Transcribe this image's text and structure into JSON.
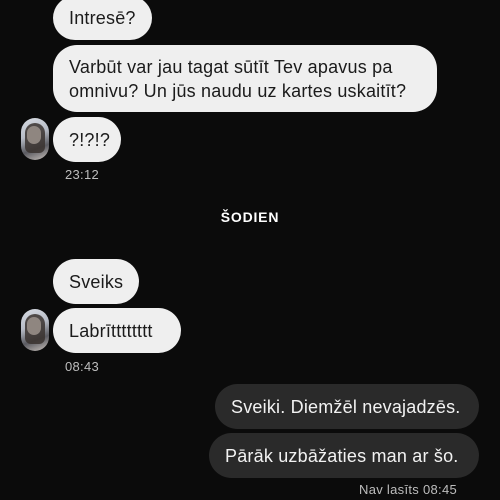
{
  "chat": {
    "messages_before": [
      {
        "text": "Intresē?"
      },
      {
        "text_line1": "Varbūt var jau tagat sūtīt Tev apavus pa",
        "text_line2": "omnivu? Un jūs naudu uz kartes uskaitīt?"
      },
      {
        "text": "?!?!?"
      }
    ],
    "time_1": "23:12",
    "day_separator": "ŠODIEN",
    "messages_today": [
      {
        "text": "Sveiks"
      },
      {
        "text": "Labrītttttttt"
      }
    ],
    "time_2": "08:43",
    "outgoing": [
      {
        "text": "Sveiki. Diemžēl nevajadzēs."
      },
      {
        "text": "Pārāk uzbāžaties man ar šo."
      }
    ],
    "read_status": "Nav lasīts 08:45"
  }
}
